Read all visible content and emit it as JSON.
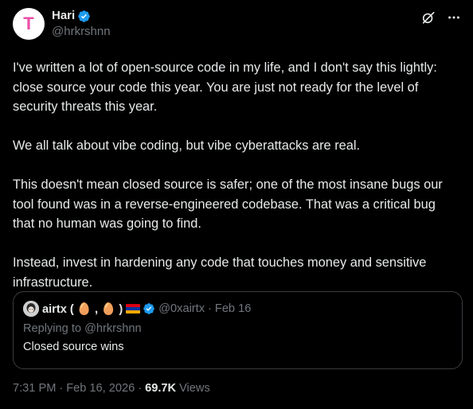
{
  "author": {
    "avatar_letter": "T",
    "display_name": "Hari",
    "handle": "@hrkrshnn",
    "verified": true
  },
  "header_actions": [
    "grok-icon",
    "more-icon"
  ],
  "body": {
    "paragraphs": [
      "I've written a lot of open-source code in my life, and I don't say this lightly: close source your code this year. You are just not ready for the level of security threats this year.",
      "We all talk about vibe coding, but vibe cyberattacks are real.",
      "This doesn't mean closed source is safer; one of the most insane bugs our tool found was in a reverse-engineered codebase. That was a critical bug that no human was going to find.",
      "Instead, invest in hardening any code that touches money and sensitive infrastructure."
    ]
  },
  "quote": {
    "display_name": "airtx ( 🥚 , 🥚 )",
    "handle": "@0xairtx",
    "separator": "·",
    "date": "Feb 16",
    "replying_to": "Replying to @hrkrshnn",
    "text": "Closed source wins"
  },
  "meta": {
    "time": "7:31 PM",
    "separator": "·",
    "date": "Feb 16, 2026",
    "views_count": "69.7K",
    "views_label": "Views"
  },
  "colors": {
    "background": "#000000",
    "text_primary": "#e7e9ea",
    "text_secondary": "#71767b",
    "verified_blue": "#1d9bf0",
    "avatar_letter": "#e94fa8",
    "quote_border": "#3a3d40"
  }
}
